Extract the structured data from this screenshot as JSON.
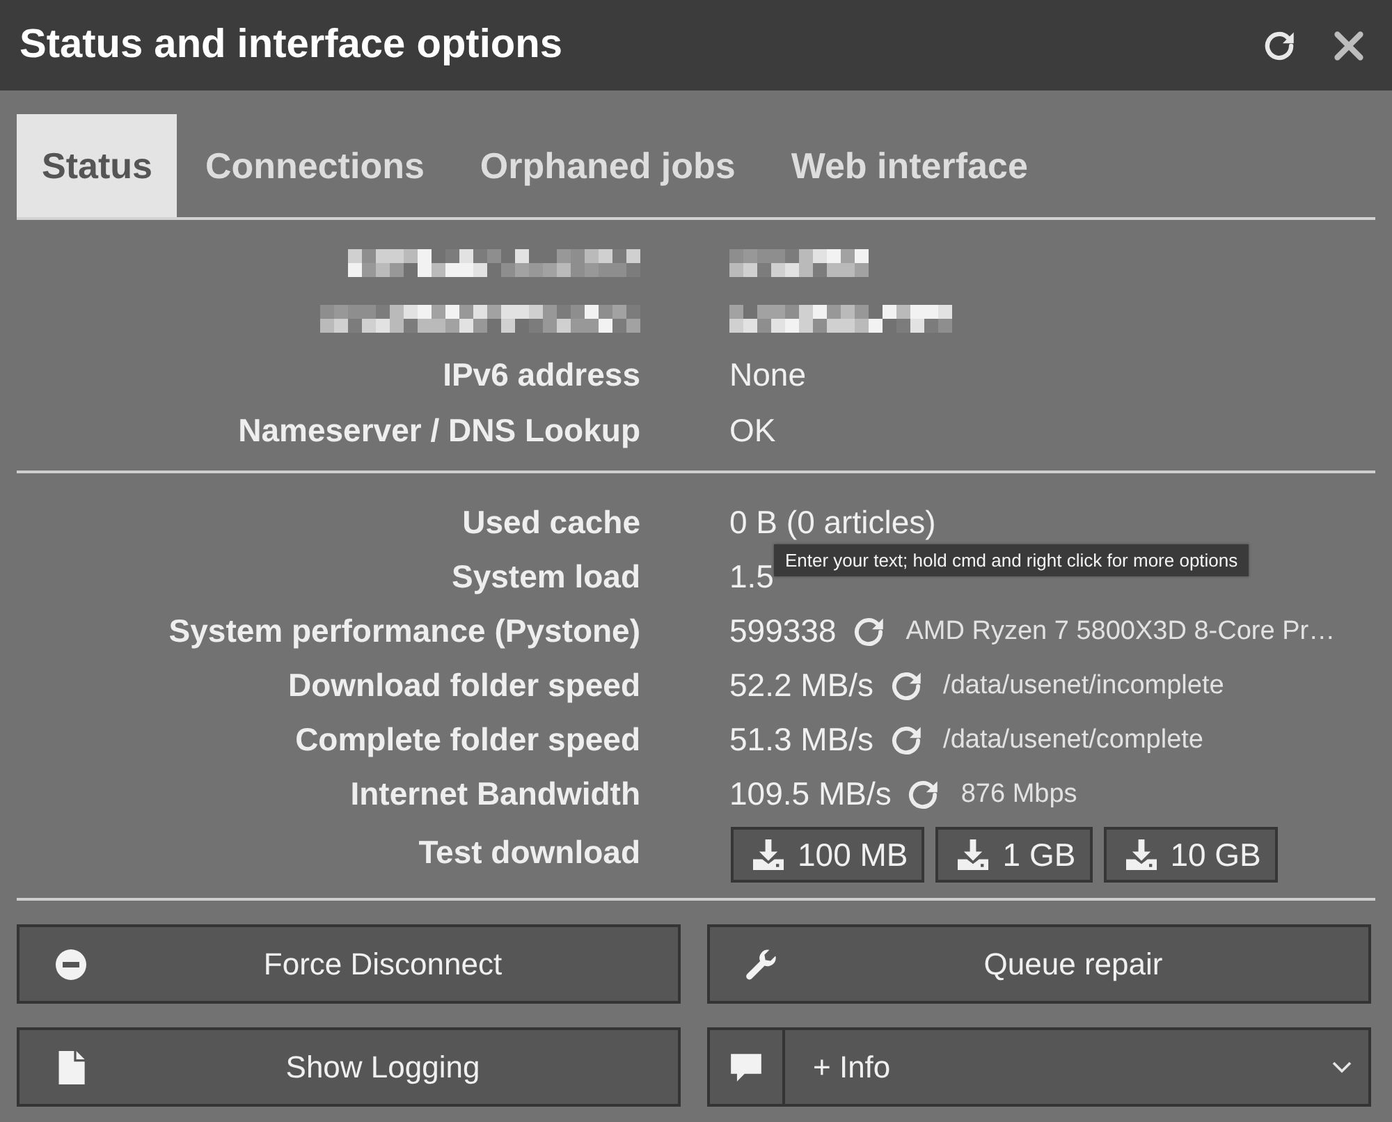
{
  "window": {
    "title": "Status and interface options"
  },
  "tabs": [
    {
      "label": "Status",
      "selected": true
    },
    {
      "label": "Connections",
      "selected": false
    },
    {
      "label": "Orphaned jobs",
      "selected": false
    },
    {
      "label": "Web interface",
      "selected": false
    }
  ],
  "sections": [
    {
      "rows": [
        {
          "kind": "redacted"
        },
        {
          "kind": "redacted"
        },
        {
          "kind": "text",
          "label": "IPv6 address",
          "value": "None"
        },
        {
          "kind": "text",
          "label": "Nameserver / DNS Lookup",
          "value": "OK"
        }
      ]
    },
    {
      "rows": [
        {
          "kind": "text",
          "label": "Used cache",
          "value": "0 B (0 articles)"
        },
        {
          "kind": "text",
          "label": "System load",
          "value": "1.5",
          "tooltip": "Enter your text; hold cmd and right click for more options"
        },
        {
          "kind": "retest",
          "label": "System performance (Pystone)",
          "value": "599338",
          "detail": "AMD Ryzen 7 5800X3D 8-Core Pr…"
        },
        {
          "kind": "retest",
          "label": "Download folder speed",
          "value": "52.2 MB/s",
          "detail": "/data/usenet/incomplete"
        },
        {
          "kind": "retest",
          "label": "Complete folder speed",
          "value": "51.3 MB/s",
          "detail": "/data/usenet/complete"
        },
        {
          "kind": "retest",
          "label": "Internet Bandwidth",
          "value": "109.5 MB/s",
          "detail": "876 Mbps"
        },
        {
          "kind": "downloads",
          "label": "Test download",
          "buttons": [
            "100 MB",
            "1 GB",
            "10 GB"
          ]
        }
      ]
    }
  ],
  "actions": [
    {
      "kind": "button",
      "label": "Force Disconnect"
    },
    {
      "kind": "button",
      "label": "Queue repair"
    },
    {
      "kind": "button",
      "label": "Show Logging"
    },
    {
      "kind": "dropdown",
      "label": "+ Info"
    }
  ]
}
